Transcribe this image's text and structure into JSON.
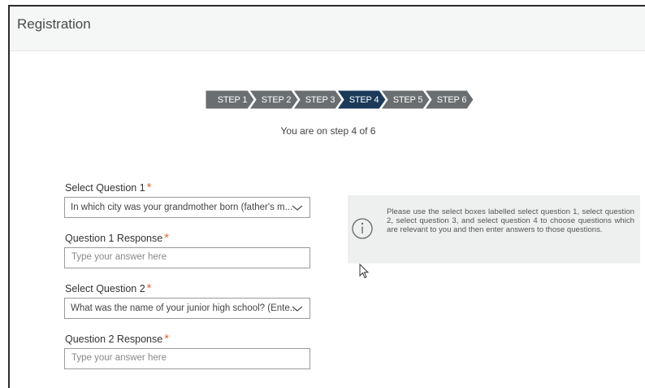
{
  "header": {
    "title": "Registration"
  },
  "stepper": {
    "steps": [
      "STEP 1",
      "STEP 2",
      "STEP 3",
      "STEP 4",
      "STEP 5",
      "STEP 6"
    ],
    "current_index": 4,
    "status_text": "You are on step 4 of 6",
    "colors": {
      "inactive": "#6b6e70",
      "active": "#1b3a5a"
    }
  },
  "form": {
    "q1_label": "Select Question 1",
    "q1_value": "In which city was your grandmother born (father's m...",
    "r1_label": "Question 1 Response",
    "r1_placeholder": "Type your answer here",
    "q2_label": "Select Question 2",
    "q2_value": "What was the name of your junior high school? (Ente...",
    "r2_label": "Question 2 Response",
    "r2_placeholder": "Type your answer here",
    "required_mark": "*"
  },
  "info": {
    "text": "Please use the select boxes labelled select question 1, select question 2, select question 3, and select question 4 to choose questions which are relevant to you and then enter answers to those questions.",
    "icon": "info-circle-icon"
  },
  "colors": {
    "required": "#e06a3a",
    "panel_bg": "#eef0f0"
  }
}
